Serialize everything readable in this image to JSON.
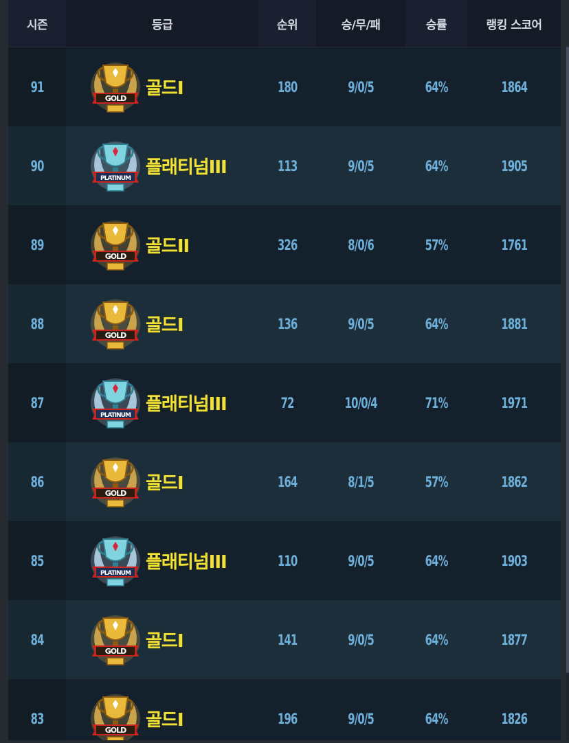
{
  "header": {
    "season": "시즌",
    "grade": "등급",
    "rank": "순위",
    "wdl": "승/무/패",
    "win_rate": "승률",
    "ranking_score": "랭킹 스코어"
  },
  "colors": {
    "gold_text": "#f1e23a",
    "value_text": "#6fb0da",
    "header_bg": "#151a26",
    "row_dark": "#14202b",
    "row_light": "#1c2e3a"
  },
  "rows": [
    {
      "season": "91",
      "tier": "gold",
      "emblem_label": "GOLD",
      "grade": "골드I",
      "rank": "180",
      "wdl": "9/0/5",
      "win_rate": "64%",
      "score": "1864"
    },
    {
      "season": "90",
      "tier": "platinum",
      "emblem_label": "PLATINUM",
      "grade": "플래티넘III",
      "rank": "113",
      "wdl": "9/0/5",
      "win_rate": "64%",
      "score": "1905"
    },
    {
      "season": "89",
      "tier": "gold",
      "emblem_label": "GOLD",
      "grade": "골드II",
      "rank": "326",
      "wdl": "8/0/6",
      "win_rate": "57%",
      "score": "1761"
    },
    {
      "season": "88",
      "tier": "gold",
      "emblem_label": "GOLD",
      "grade": "골드I",
      "rank": "136",
      "wdl": "9/0/5",
      "win_rate": "64%",
      "score": "1881"
    },
    {
      "season": "87",
      "tier": "platinum",
      "emblem_label": "PLATINUM",
      "grade": "플래티넘III",
      "rank": "72",
      "wdl": "10/0/4",
      "win_rate": "71%",
      "score": "1971"
    },
    {
      "season": "86",
      "tier": "gold",
      "emblem_label": "GOLD",
      "grade": "골드I",
      "rank": "164",
      "wdl": "8/1/5",
      "win_rate": "57%",
      "score": "1862"
    },
    {
      "season": "85",
      "tier": "platinum",
      "emblem_label": "PLATINUM",
      "grade": "플래티넘III",
      "rank": "110",
      "wdl": "9/0/5",
      "win_rate": "64%",
      "score": "1903"
    },
    {
      "season": "84",
      "tier": "gold",
      "emblem_label": "GOLD",
      "grade": "골드I",
      "rank": "141",
      "wdl": "9/0/5",
      "win_rate": "64%",
      "score": "1877"
    },
    {
      "season": "83",
      "tier": "gold",
      "emblem_label": "GOLD",
      "grade": "골드I",
      "rank": "196",
      "wdl": "9/0/5",
      "win_rate": "64%",
      "score": "1826"
    }
  ]
}
